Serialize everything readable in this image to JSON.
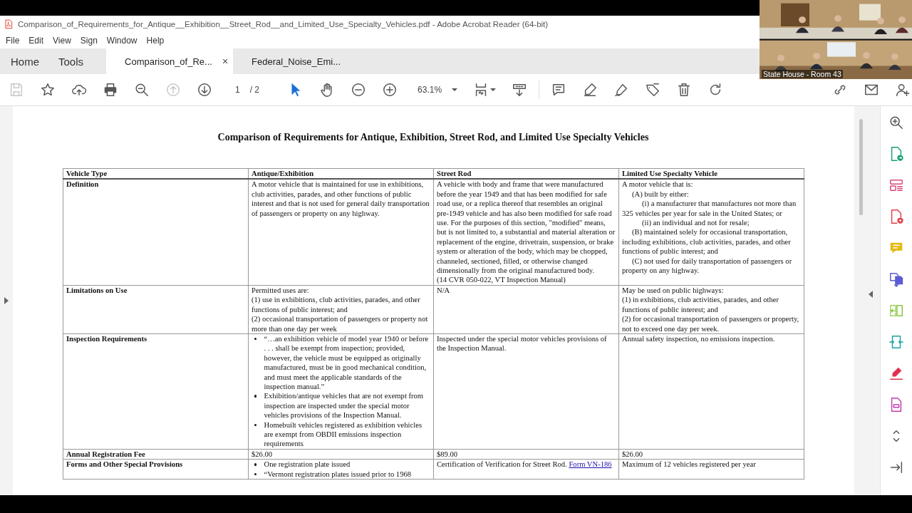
{
  "window": {
    "title": "Comparison_of_Requirements_for_Antique__Exhibition__Street_Rod__and_Limited_Use_Specialty_Vehicles.pdf - Adobe Acrobat Reader (64-bit)"
  },
  "menu": [
    "File",
    "Edit",
    "View",
    "Sign",
    "Window",
    "Help"
  ],
  "tabs": [
    {
      "label": "Home",
      "kind": "nav",
      "selected": false
    },
    {
      "label": "Tools",
      "kind": "nav",
      "selected": false
    },
    {
      "label": "Comparison_of_Re...",
      "kind": "doc",
      "selected": true,
      "close": "×"
    },
    {
      "label": "Federal_Noise_Emi...",
      "kind": "doc",
      "selected": false
    }
  ],
  "toolbar": {
    "page": "1",
    "pages": "/ 2",
    "zoom": "63.1%"
  },
  "document": {
    "title": "Comparison of Requirements for Antique, Exhibition, Street Rod, and Limited Use Specialty Vehicles",
    "columns": [
      "Vehicle Type",
      "Antique/Exhibition",
      "Street Rod",
      "Limited Use Specialty Vehicle"
    ],
    "rows": [
      {
        "cells": [
          [
            {
              "kind": "label",
              "text": "Definition"
            }
          ],
          [
            {
              "kind": "p",
              "text": "A motor vehicle that is maintained for use in exhibitions, club activities, parades, and other functions of public interest and that is not used for general daily transportation of passengers or property on any highway."
            }
          ],
          [
            {
              "kind": "p",
              "text": "A vehicle with body and frame that were manufactured before the year 1949 and that has been modified for safe road use, or a replica thereof that resembles an original pre-1949 vehicle and has also been modified for safe road use. For the purposes of this section, \"modified\" means, but is not limited to, a substantial and material alteration or replacement of the engine, drivetrain, suspension, or brake system or alteration of the body, which may be chopped, channeled, sectioned, filled, or otherwise changed dimensionally from the original manufactured body."
            },
            {
              "kind": "p",
              "text": "(14 CVR 050-022, VT Inspection Manual)"
            }
          ],
          [
            {
              "kind": "p",
              "text": "A motor vehicle that is:"
            },
            {
              "kind": "indent1",
              "text": "(A)  built by either:"
            },
            {
              "kind": "indent2",
              "text": "(i)  a manufacturer that manufactures not more than 325 vehicles per year for sale in the United States; or"
            },
            {
              "kind": "indent2",
              "text": "(ii)  an individual and not for resale;"
            },
            {
              "kind": "indent1",
              "text": "(B)  maintained solely for occasional transportation, including exhibitions, club activities, parades, and other functions of public interest; and"
            },
            {
              "kind": "indent1",
              "text": "(C)  not used for daily transportation of passengers or property on any highway."
            }
          ]
        ]
      },
      {
        "cells": [
          [
            {
              "kind": "label",
              "text": "Limitations on Use"
            }
          ],
          [
            {
              "kind": "p",
              "text": "Permitted uses are:"
            },
            {
              "kind": "p",
              "text": "(1) use in exhibitions, club activities, parades, and other functions of public interest; and"
            },
            {
              "kind": "p",
              "text": "(2) occasional transportation of passengers or property not more than one day per week"
            }
          ],
          [
            {
              "kind": "p",
              "text": "N/A"
            }
          ],
          [
            {
              "kind": "p",
              "text": "May be used on public highways:"
            },
            {
              "kind": "p",
              "text": "(1)  in exhibitions, club activities, parades, and other functions of public interest; and"
            },
            {
              "kind": "p",
              "text": "(2)  for occasional transportation of passengers or property, not to exceed one day per week."
            }
          ]
        ]
      },
      {
        "cells": [
          [
            {
              "kind": "label",
              "text": "Inspection Requirements"
            }
          ],
          [
            {
              "kind": "bullet",
              "text": "“…an exhibition vehicle of model year 1940 or before . . . shall be exempt from inspection; provided, however, the vehicle must be equipped as originally manufactured, must be in good mechanical condition, and must meet the applicable standards of the inspection manual.”"
            },
            {
              "kind": "bullet",
              "text": "Exhibition/antique vehicles that are not exempt from inspection are inspected under the special motor vehicles provisions of the Inspection Manual."
            },
            {
              "kind": "bullet",
              "text": "Homebuilt vehicles registered as exhibition vehicles are exempt from OBDII emissions inspection requirements"
            }
          ],
          [
            {
              "kind": "p",
              "text": "Inspected under the special motor vehicles provisions of the Inspection Manual."
            }
          ],
          [
            {
              "kind": "p",
              "text": "Annual safety inspection, no emissions inspection."
            }
          ]
        ]
      },
      {
        "cells": [
          [
            {
              "kind": "label",
              "text": "Annual Registration Fee"
            }
          ],
          [
            {
              "kind": "p",
              "text": "$26.00"
            }
          ],
          [
            {
              "kind": "p",
              "text": "$89.00"
            }
          ],
          [
            {
              "kind": "p",
              "text": "$26.00"
            }
          ]
        ]
      },
      {
        "cells": [
          [
            {
              "kind": "label",
              "text": "Forms and Other Special Provisions"
            }
          ],
          [
            {
              "kind": "bullet",
              "text": "One registration plate issued"
            },
            {
              "kind": "bullet",
              "text": "“Vermont registration plates issued prior to 1968"
            }
          ],
          [
            {
              "kind": "p",
              "text": "Certification of Verification for Street Rod.",
              "link": "Form VN-186"
            }
          ],
          [
            {
              "kind": "p",
              "text": "Maximum of 12 vehicles registered per year"
            }
          ]
        ]
      }
    ]
  },
  "video": {
    "caption": "State House - Room 43"
  }
}
